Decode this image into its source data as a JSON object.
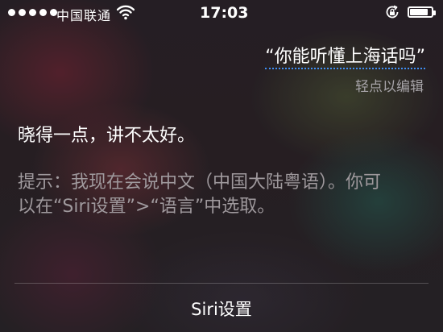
{
  "status_bar": {
    "carrier": "中国联通",
    "time": "17:03",
    "battery_level": 0.85
  },
  "query": {
    "text": "“你能听懂上海话吗”",
    "edit_hint": "轻点以编辑"
  },
  "answer": {
    "text": "晓得一点，讲不太好。"
  },
  "hint": {
    "text": "提示：我现在会说中文（中国大陆粤语）。你可以在“Siri设置”>“语言”中选取。"
  },
  "footer": {
    "siri_settings_label": "Siri设置"
  },
  "colors": {
    "accent_underline": "#3f8ef5",
    "secondary_text": "#a7a4a8"
  },
  "icons": [
    "signal-dots-icon",
    "wifi-icon",
    "rotation-lock-icon",
    "battery-icon"
  ]
}
